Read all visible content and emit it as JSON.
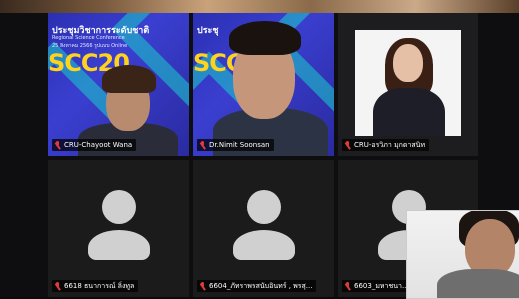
{
  "colors": {
    "background": "#0b0b0d",
    "tile": "#1b1b1c",
    "mic_muted": "#e03a3a",
    "conference_blue": "#2b2fb2",
    "conference_cyan": "#19d0c8",
    "conference_yellow": "#ffd21e"
  },
  "participants": [
    {
      "name": "CRU-Chayoot Wana",
      "muted": true,
      "video": true
    },
    {
      "name": "Dr.Nimit Soonsan",
      "muted": true,
      "video": true
    },
    {
      "name": "CRU-อรวิภา มุกดาสนิท",
      "muted": true,
      "video": true
    },
    {
      "name": "6618 ธนาการณ์ ลิ่งทูล",
      "muted": true,
      "video": false
    },
    {
      "name": "6604_ภัทราพรสนับอินทร์ , พรสุ...",
      "muted": true,
      "video": false
    },
    {
      "name": "6603_มหาชนา...",
      "muted": true,
      "video": false
    }
  ],
  "conference": {
    "title_left": "ประชุมวิชาการระดับชาติ",
    "title_mid": "ประชุ",
    "subtitle": "Regional Science Conference",
    "date": "25 สิงหาคม 2566 รูปแบบ Online",
    "logo_left": "SCC20",
    "logo_mid": "SCC"
  }
}
